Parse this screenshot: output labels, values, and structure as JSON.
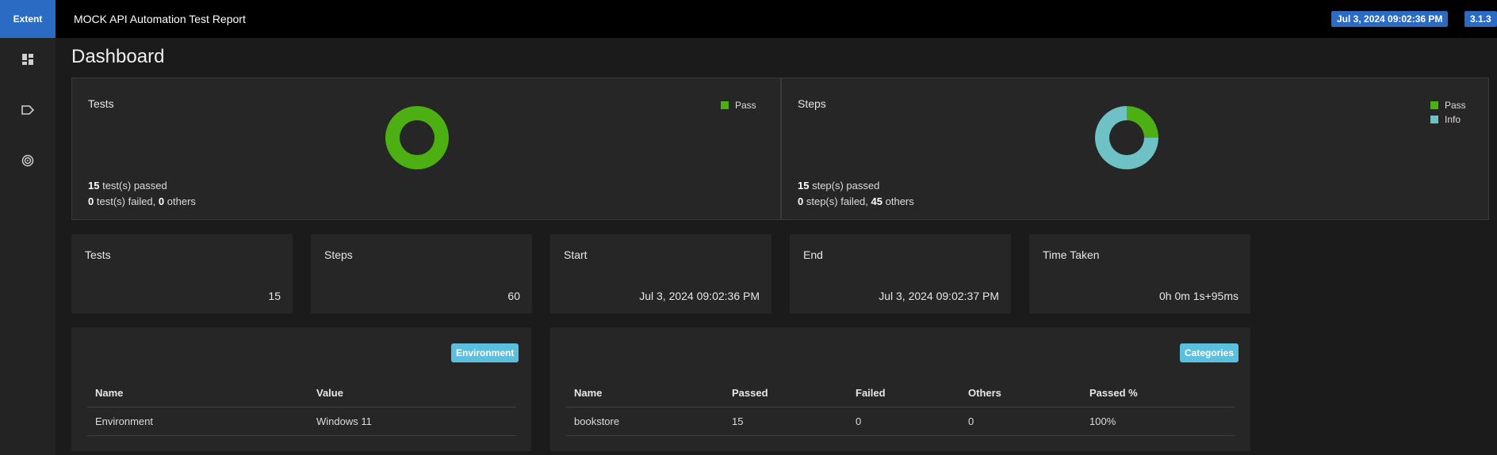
{
  "header": {
    "brand": "Extent",
    "title": "MOCK API Automation Test Report",
    "date_badge": "Jul 3, 2024 09:02:36 PM",
    "version_badge": "3.1.3"
  },
  "sidebar": {
    "items": [
      {
        "icon": "dashboard-icon"
      },
      {
        "icon": "tag-icon"
      },
      {
        "icon": "exception-icon"
      }
    ]
  },
  "page": {
    "title": "Dashboard"
  },
  "colors": {
    "pass": "#4caf12",
    "info": "#6ec2c6",
    "accent": "#2c6bc4",
    "tag": "#5bc0de"
  },
  "tests_chart": {
    "title": "Tests",
    "legend": [
      "Pass"
    ],
    "passed_count": "15",
    "passed_text": "test(s) passed",
    "failed_count": "0",
    "failed_text": "test(s) failed,",
    "others_count": "0",
    "others_text": "others"
  },
  "steps_chart": {
    "title": "Steps",
    "legend": [
      "Pass",
      "Info"
    ],
    "passed_count": "15",
    "passed_text": "step(s) passed",
    "failed_count": "0",
    "failed_text": "step(s) failed,",
    "others_count": "45",
    "others_text": "others"
  },
  "chart_data": [
    {
      "type": "pie",
      "title": "Tests",
      "categories": [
        "Pass"
      ],
      "values": [
        15
      ],
      "donut": true
    },
    {
      "type": "pie",
      "title": "Steps",
      "categories": [
        "Pass",
        "Info"
      ],
      "values": [
        15,
        45
      ],
      "donut": true
    }
  ],
  "stats": {
    "tests": {
      "label": "Tests",
      "value": "15"
    },
    "steps": {
      "label": "Steps",
      "value": "60"
    },
    "start": {
      "label": "Start",
      "value": "Jul 3, 2024 09:02:36 PM"
    },
    "end": {
      "label": "End",
      "value": "Jul 3, 2024 09:02:37 PM"
    },
    "time": {
      "label": "Time Taken",
      "value": "0h 0m 1s+95ms"
    }
  },
  "environment": {
    "tag": "Environment",
    "headers": [
      "Name",
      "Value"
    ],
    "rows": [
      [
        "Environment",
        "Windows 11"
      ]
    ]
  },
  "categories": {
    "tag": "Categories",
    "headers": [
      "Name",
      "Passed",
      "Failed",
      "Others",
      "Passed %"
    ],
    "rows": [
      [
        "bookstore",
        "15",
        "0",
        "0",
        "100%"
      ]
    ]
  }
}
